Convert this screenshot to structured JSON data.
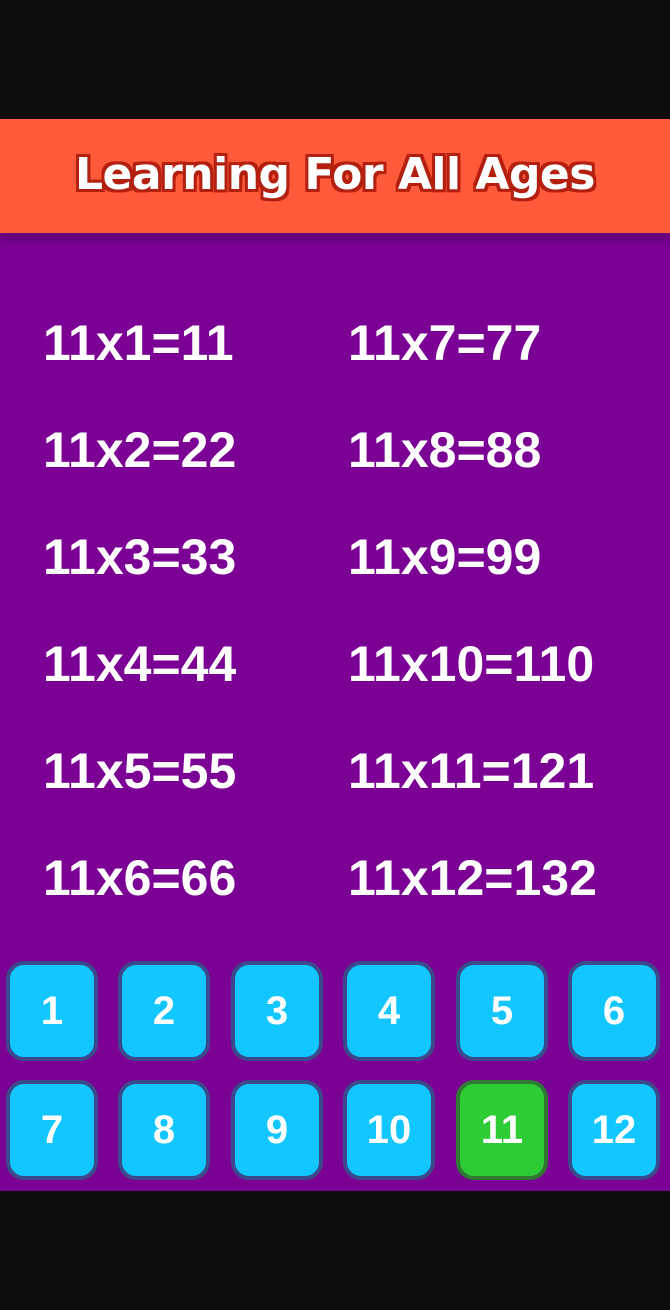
{
  "header": {
    "title": "Learning For All Ages",
    "background_color": "#ff5b3a"
  },
  "table": {
    "background_color": "#7b0094",
    "facts": [
      "11x1=11",
      "11x2=22",
      "11x3=33",
      "11x4=44",
      "11x5=55",
      "11x6=66",
      "11x7=77",
      "11x8=88",
      "11x9=99",
      "11x10=110",
      "11x11=121",
      "11x12=132"
    ]
  },
  "number_picker": {
    "button_color": "#12c6ff",
    "selected_color": "#2dcc34",
    "selected": "11",
    "buttons": [
      "1",
      "2",
      "3",
      "4",
      "5",
      "6",
      "7",
      "8",
      "9",
      "10",
      "11",
      "12"
    ]
  }
}
